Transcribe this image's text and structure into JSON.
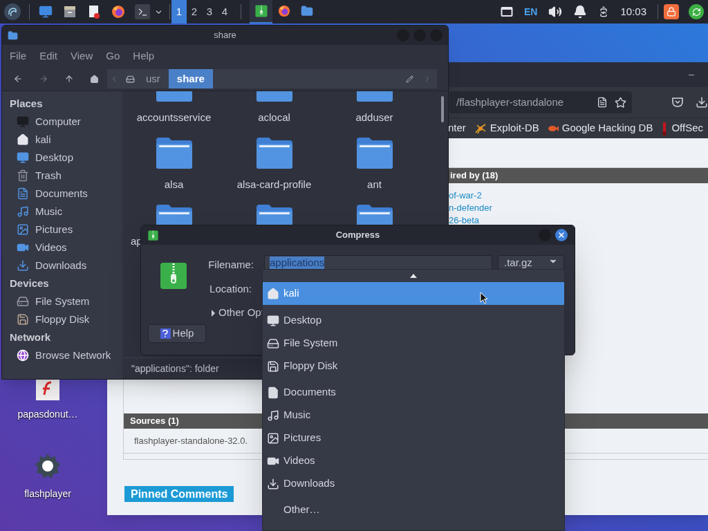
{
  "taskbar": {
    "workspaces": [
      {
        "label": "1",
        "selected": true
      },
      {
        "label": "2",
        "selected": false
      },
      {
        "label": "3",
        "selected": false
      },
      {
        "label": "4",
        "selected": false
      }
    ],
    "tasks": [
      {
        "kind": "archive",
        "selected": true
      },
      {
        "kind": "browser",
        "selected": false
      },
      {
        "kind": "folder",
        "selected": false
      }
    ],
    "language": "EN",
    "clock": "10:03"
  },
  "browser": {
    "url": "/flashplayer-standalone",
    "bookmarks": [
      {
        "label": "nter"
      },
      {
        "label": "Exploit-DB",
        "kind": "spider"
      },
      {
        "label": "Google Hacking DB",
        "kind": "fish"
      },
      {
        "label": "OffSec",
        "kind": "flag"
      }
    ],
    "section": "ired by (18)",
    "links": [
      "of-war-2",
      "n-defender",
      "26-beta"
    ],
    "sources_heading": "Sources (1)",
    "source": "flashplayer-standalone-32.0.",
    "pinned": "Pinned Comments"
  },
  "desktop_icons": [
    {
      "label": "papasdonut…",
      "kind": "flash"
    },
    {
      "label": "flashplayer",
      "kind": "gear"
    }
  ],
  "file_manager": {
    "title": "share",
    "menu": [
      "File",
      "Edit",
      "View",
      "Go",
      "Help"
    ],
    "path": [
      {
        "label": "usr",
        "selected": false
      },
      {
        "label": "share",
        "selected": true
      }
    ],
    "sidebar": [
      {
        "heading": "Places",
        "items": [
          {
            "label": "Computer",
            "kind": "computer"
          },
          {
            "label": "kali",
            "kind": "home"
          },
          {
            "label": "Desktop",
            "kind": "desktop"
          },
          {
            "label": "Trash",
            "kind": "trash"
          },
          {
            "label": "Documents",
            "kind": "documents"
          },
          {
            "label": "Music",
            "kind": "music"
          },
          {
            "label": "Pictures",
            "kind": "pictures"
          },
          {
            "label": "Videos",
            "kind": "videos"
          },
          {
            "label": "Downloads",
            "kind": "downloads"
          }
        ]
      },
      {
        "heading": "Devices",
        "items": [
          {
            "label": "File System",
            "kind": "disk"
          },
          {
            "label": "Floppy Disk",
            "kind": "floppy"
          }
        ]
      },
      {
        "heading": "Network",
        "items": [
          {
            "label": "Browse Network",
            "kind": "network"
          }
        ]
      }
    ],
    "files": [
      {
        "kind": "folder",
        "label": "accountsservice"
      },
      {
        "kind": "folder",
        "label": "aclocal"
      },
      {
        "kind": "folder",
        "label": "adduser"
      },
      {
        "kind": "folder",
        "label": "alsa"
      },
      {
        "kind": "folder",
        "label": "alsa-card-profile"
      },
      {
        "kind": "folder",
        "label": "ant"
      },
      {
        "kind": "folder",
        "label": "ap"
      },
      {
        "kind": "folder"
      },
      {
        "kind": "folder"
      }
    ],
    "status": "\"applications\": folder"
  },
  "compress": {
    "title": "Compress",
    "filename_label": "Filename:",
    "filename": "applications",
    "filename_selected": true,
    "extension": ".tar.gz",
    "location_label": "Location:",
    "other_options": "Other Opt",
    "help": "Help",
    "location_menu": [
      {
        "items": [
          {
            "label": "kali",
            "kind": "home",
            "selected": true
          },
          {
            "label": "Desktop",
            "kind": "desktop",
            "selected": false
          },
          {
            "label": "File System",
            "kind": "disk",
            "selected": false
          },
          {
            "label": "Floppy Disk",
            "kind": "floppy",
            "selected": false
          }
        ]
      },
      {
        "items": [
          {
            "label": "Documents",
            "kind": "documents",
            "selected": false
          },
          {
            "label": "Music",
            "kind": "music",
            "selected": false
          },
          {
            "label": "Pictures",
            "kind": "pictures",
            "selected": false
          },
          {
            "label": "Videos",
            "kind": "videos",
            "selected": false
          },
          {
            "label": "Downloads",
            "kind": "downloads",
            "selected": false
          }
        ]
      },
      {
        "items": [
          {
            "label": "Other…",
            "kind": "other",
            "selected": false
          }
        ]
      }
    ]
  }
}
